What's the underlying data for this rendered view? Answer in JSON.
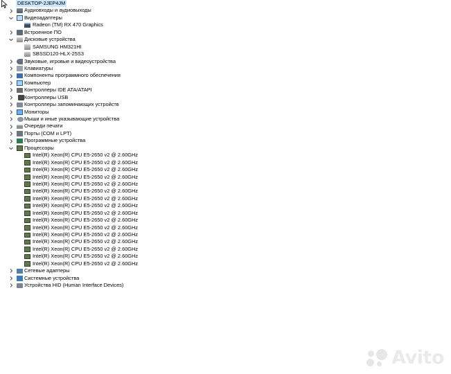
{
  "root": {
    "label": "DESKTOP-2JEP4JM"
  },
  "categories": [
    {
      "id": "audio-inputs",
      "label": "Аудиовходы и аудиовыходы",
      "expanded": false,
      "icon": "audio-icon"
    },
    {
      "id": "display-adapters",
      "label": "Видеоадаптеры",
      "expanded": true,
      "icon": "display-adapter-icon",
      "children": [
        {
          "label": "Radeon (TM) RX 470 Graphics",
          "icon": "gpu-icon"
        }
      ]
    },
    {
      "id": "firmware",
      "label": "Встроенное ПО",
      "expanded": false,
      "icon": "firmware-icon"
    },
    {
      "id": "disk-drives",
      "label": "Дисковые устройства",
      "expanded": true,
      "icon": "disk-icon",
      "children": [
        {
          "label": "SAMSUNG HM321HI",
          "icon": "disk-icon"
        },
        {
          "label": "SBSSD120-HLX-25S3",
          "icon": "disk-icon"
        }
      ]
    },
    {
      "id": "sound",
      "label": "Звуковые, игровые и видеоустройства",
      "expanded": false,
      "icon": "sound-icon"
    },
    {
      "id": "keyboards",
      "label": "Клавиатуры",
      "expanded": false,
      "icon": "keyboard-icon"
    },
    {
      "id": "software-components",
      "label": "Компоненты программного обеспечения",
      "expanded": false,
      "icon": "software-icon"
    },
    {
      "id": "computer",
      "label": "Компьютер",
      "expanded": false,
      "icon": "computer-icon"
    },
    {
      "id": "ide",
      "label": "Контроллеры IDE ATA/ATAPI",
      "expanded": false,
      "icon": "ide-icon"
    },
    {
      "id": "usb",
      "label": "Контроллеры USB",
      "expanded": false,
      "icon": "usb-icon"
    },
    {
      "id": "storage",
      "label": "Контроллеры запоминающих устройств",
      "expanded": false,
      "icon": "storage-icon"
    },
    {
      "id": "monitors",
      "label": "Мониторы",
      "expanded": false,
      "icon": "monitor-icon"
    },
    {
      "id": "mice",
      "label": "Мыши и иные указывающие устройства",
      "expanded": false,
      "icon": "mouse-icon"
    },
    {
      "id": "print-queues",
      "label": "Очереди печати",
      "expanded": false,
      "icon": "printer-icon"
    },
    {
      "id": "ports",
      "label": "Порты (COM и LPT)",
      "expanded": false,
      "icon": "port-icon"
    },
    {
      "id": "software-devices",
      "label": "Программные устройства",
      "expanded": false,
      "icon": "chip-icon"
    },
    {
      "id": "processors",
      "label": "Процессоры",
      "expanded": true,
      "icon": "cpu-icon",
      "children": [
        {
          "label": "Intel(R) Xeon(R) CPU E5-2650 v2 @ 2.60GHz",
          "icon": "cpu-icon"
        },
        {
          "label": "Intel(R) Xeon(R) CPU E5-2650 v2 @ 2.60GHz",
          "icon": "cpu-icon"
        },
        {
          "label": "Intel(R) Xeon(R) CPU E5-2650 v2 @ 2.60GHz",
          "icon": "cpu-icon"
        },
        {
          "label": "Intel(R) Xeon(R) CPU E5-2650 v2 @ 2.60GHz",
          "icon": "cpu-icon"
        },
        {
          "label": "Intel(R) Xeon(R) CPU E5-2650 v2 @ 2.60GHz",
          "icon": "cpu-icon"
        },
        {
          "label": "Intel(R) Xeon(R) CPU E5-2650 v2 @ 2.60GHz",
          "icon": "cpu-icon"
        },
        {
          "label": "Intel(R) Xeon(R) CPU E5-2650 v2 @ 2.60GHz",
          "icon": "cpu-icon"
        },
        {
          "label": "Intel(R) Xeon(R) CPU E5-2650 v2 @ 2.60GHz",
          "icon": "cpu-icon"
        },
        {
          "label": "Intel(R) Xeon(R) CPU E5-2650 v2 @ 2.60GHz",
          "icon": "cpu-icon"
        },
        {
          "label": "Intel(R) Xeon(R) CPU E5-2650 v2 @ 2.60GHz",
          "icon": "cpu-icon"
        },
        {
          "label": "Intel(R) Xeon(R) CPU E5-2650 v2 @ 2.60GHz",
          "icon": "cpu-icon"
        },
        {
          "label": "Intel(R) Xeon(R) CPU E5-2650 v2 @ 2.60GHz",
          "icon": "cpu-icon"
        },
        {
          "label": "Intel(R) Xeon(R) CPU E5-2650 v2 @ 2.60GHz",
          "icon": "cpu-icon"
        },
        {
          "label": "Intel(R) Xeon(R) CPU E5-2650 v2 @ 2.60GHz",
          "icon": "cpu-icon"
        },
        {
          "label": "Intel(R) Xeon(R) CPU E5-2650 v2 @ 2.60GHz",
          "icon": "cpu-icon"
        },
        {
          "label": "Intel(R) Xeon(R) CPU E5-2650 v2 @ 2.60GHz",
          "icon": "cpu-icon"
        }
      ]
    },
    {
      "id": "network",
      "label": "Сетевые адаптеры",
      "expanded": false,
      "icon": "network-adapter-icon"
    },
    {
      "id": "system-devices",
      "label": "Системные устройства",
      "expanded": false,
      "icon": "system-device-icon"
    },
    {
      "id": "hid",
      "label": "Устройства HID (Human Interface Devices)",
      "expanded": false,
      "icon": "hid-icon"
    }
  ],
  "watermark": {
    "text": "Avito"
  },
  "colors": {
    "selection": "#cce8ff",
    "chevron": "#404040"
  }
}
